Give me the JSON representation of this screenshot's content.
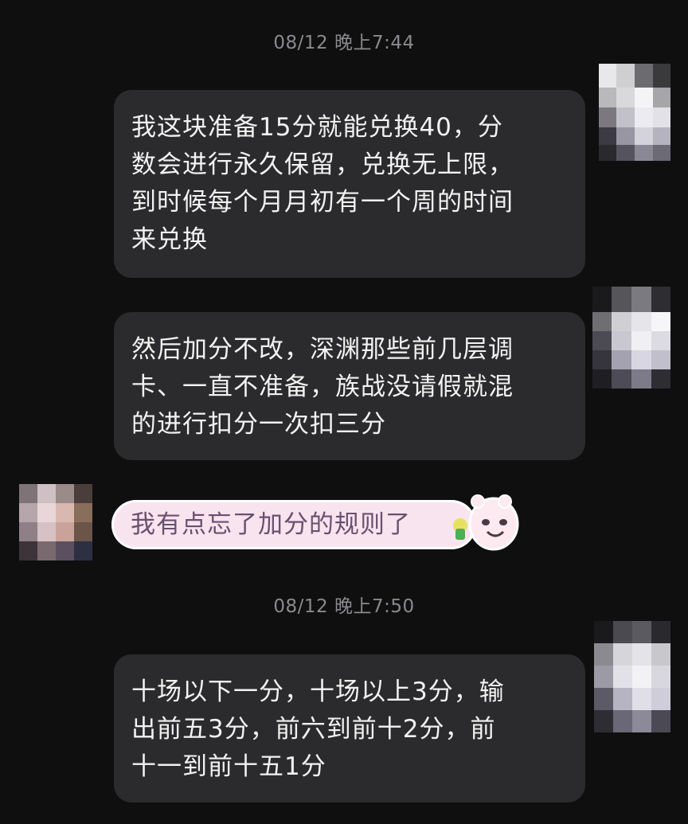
{
  "timestamps": {
    "first": "08/12 晚上7:44",
    "second": "08/12 晚上7:50"
  },
  "messages": {
    "m1": {
      "lines": [
        "我这块准备15分就能兑换40，分",
        "数会进行永久保留，兑换无上限，",
        "到时候每个月月初有一个周的时间",
        "来兑换"
      ]
    },
    "m2": {
      "lines": [
        "然后加分不改，深渊那些前几层调",
        "卡、一直不准备，族战没请假就混",
        "的进行扣分一次扣三分"
      ]
    },
    "m3": {
      "text": "我有点忘了加分的规则了"
    },
    "m4": {
      "lines": [
        "十场以下一分，十场以上3分，输",
        "出前五3分，前六到前十2分，前",
        "十一到前十五1分"
      ]
    }
  },
  "colors": {
    "background": "#0f0f10",
    "bubble": "#2b2b2d",
    "pink_bubble": "#f8e4ee",
    "timestamp": "#8a8a8e"
  },
  "icons": [
    "avatar-self-pixelated",
    "avatar-other-pixelated",
    "cartoon-sticker-icon"
  ]
}
